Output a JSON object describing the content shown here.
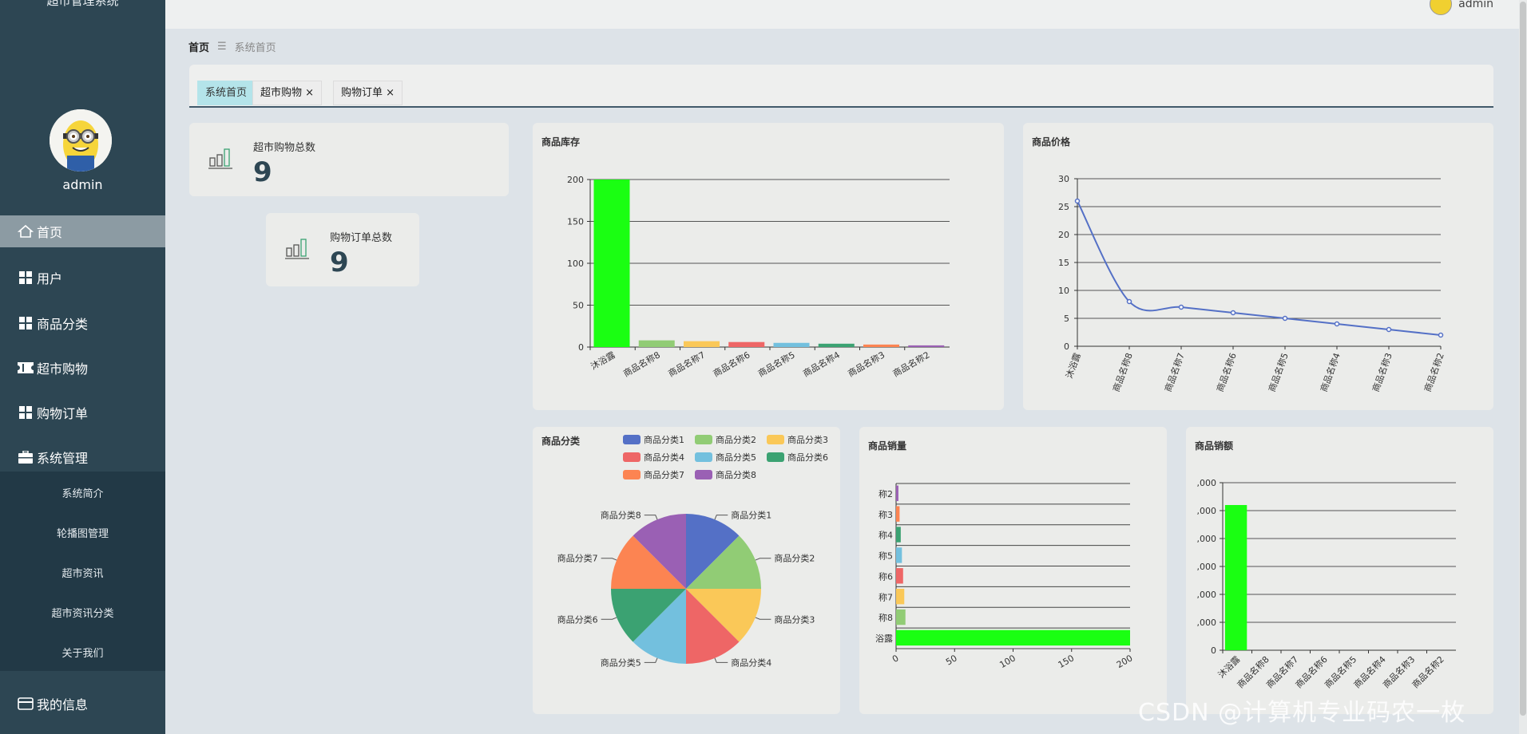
{
  "app": {
    "title": "超市管理系统"
  },
  "user": {
    "name": "admin"
  },
  "sidebar": {
    "items": [
      {
        "label": "首页",
        "icon": "home-icon"
      },
      {
        "label": "用户",
        "icon": "grid-icon"
      },
      {
        "label": "商品分类",
        "icon": "grid-icon"
      },
      {
        "label": "超市购物",
        "icon": "ticket-icon"
      },
      {
        "label": "购物订单",
        "icon": "grid-icon"
      },
      {
        "label": "系统管理",
        "icon": "briefcase-icon"
      }
    ],
    "submenu": [
      "系统简介",
      "轮播图管理",
      "超市资讯",
      "超市资讯分类",
      "关于我们"
    ],
    "my_info": "我的信息"
  },
  "breadcrumb": {
    "home": "首页",
    "separator": "☰",
    "current": "系统首页"
  },
  "tabs": [
    {
      "label": "系统首页",
      "closable": false
    },
    {
      "label": "超市购物",
      "closable": true
    },
    {
      "label": "购物订单",
      "closable": true
    }
  ],
  "stats": [
    {
      "label": "超市购物总数",
      "value": "9"
    },
    {
      "label": "购物订单总数",
      "value": "9"
    }
  ],
  "chart_titles": {
    "stock": "商品库存",
    "price": "商品价格",
    "category": "商品分类",
    "sales_qty": "商品销量",
    "sales_amount": "商品销额"
  },
  "watermark": "CSDN @计算机专业码农一枚",
  "colors": {
    "sidebar": "#2d4653",
    "accent_bar": "#1aff12",
    "line": "#5470c6"
  },
  "chart_data": [
    {
      "id": "stock",
      "type": "bar",
      "title": "商品库存",
      "categories": [
        "沐浴露",
        "商品名称8",
        "商品名称7",
        "商品名称6",
        "商品名称5",
        "商品名称4",
        "商品名称3",
        "商品名称2"
      ],
      "values": [
        200,
        8,
        7,
        6,
        5,
        4,
        3,
        2
      ],
      "colors": [
        "#1aff12",
        "#91cc75",
        "#fac858",
        "#ee6666",
        "#73c0de",
        "#3ba272",
        "#fc8452",
        "#9a60b4"
      ],
      "ylim": [
        0,
        200
      ],
      "yticks": [
        0,
        50,
        100,
        150,
        200
      ],
      "grid": true
    },
    {
      "id": "price",
      "type": "line",
      "title": "商品价格",
      "categories": [
        "沐浴露",
        "商品名称8",
        "商品名称7",
        "商品名称6",
        "商品名称5",
        "商品名称4",
        "商品名称3",
        "商品名称2"
      ],
      "values": [
        26,
        8,
        7,
        6,
        5,
        4,
        3,
        2
      ],
      "ylim": [
        0,
        30
      ],
      "yticks": [
        0,
        5,
        10,
        15,
        20,
        25,
        30
      ],
      "smooth": true,
      "grid": true
    },
    {
      "id": "category",
      "type": "pie",
      "title": "商品分类",
      "labels": [
        "商品分类1",
        "商品分类2",
        "商品分类3",
        "商品分类4",
        "商品分类5",
        "商品分类6",
        "商品分类7",
        "商品分类8"
      ],
      "values": [
        1,
        1,
        1,
        1,
        1,
        1,
        1,
        1
      ],
      "colors": [
        "#5470c6",
        "#91cc75",
        "#fac858",
        "#ee6666",
        "#73c0de",
        "#3ba272",
        "#fc8452",
        "#9a60b4"
      ],
      "legend": "top"
    },
    {
      "id": "sales_qty",
      "type": "bar",
      "orientation": "horizontal",
      "title": "商品销量",
      "categories": [
        "浴露",
        "称8",
        "称7",
        "称6",
        "称5",
        "称4",
        "称3",
        "称2"
      ],
      "values": [
        200,
        8,
        7,
        6,
        5,
        4,
        3,
        2
      ],
      "colors": [
        "#1aff12",
        "#91cc75",
        "#fac858",
        "#ee6666",
        "#73c0de",
        "#3ba272",
        "#fc8452",
        "#9a60b4"
      ],
      "xlim": [
        0,
        200
      ],
      "xticks": [
        "0",
        "50",
        "100",
        "150",
        "200"
      ],
      "grid": true
    },
    {
      "id": "sales_amount",
      "type": "bar",
      "title": "商品销额",
      "categories": [
        "沐浴露",
        "商品名称8",
        "商品名称7",
        "商品名称6",
        "商品名称5",
        "商品名称4",
        "商品名称3",
        "商品名称2"
      ],
      "values": [
        5200,
        0,
        0,
        0,
        0,
        0,
        0,
        0
      ],
      "color": "#1aff12",
      "ylim": [
        0,
        6000
      ],
      "ytick_labels": [
        "0",
        ",000",
        ",000",
        ",000",
        ",000",
        ",000",
        ",000"
      ],
      "grid": true
    }
  ]
}
